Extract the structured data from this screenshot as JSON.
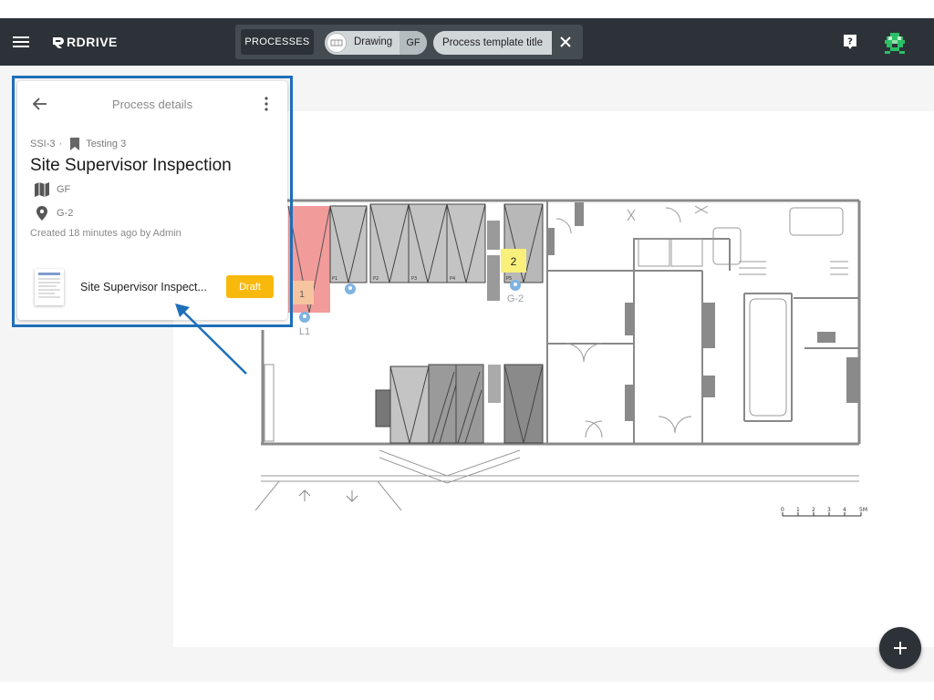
{
  "app": {
    "brand": "RDRIVE"
  },
  "toolbar": {
    "processes_label": "PROCESSES",
    "drawing_chip_label": "Drawing",
    "floor_chip_label": "GF",
    "template_chip_label": "Process template title"
  },
  "card": {
    "title": "Process details",
    "code": "SSI-3",
    "bookmark_label": "Testing 3",
    "process_title": "Site Supervisor Inspection",
    "floor": "GF",
    "location": "G-2",
    "created": "Created 18 minutes ago by Admin",
    "document_name": "Site Supervisor Inspect...",
    "status_label": "Draft"
  },
  "plan": {
    "pin_g2_number": "2",
    "pin_g2_label": "G-2",
    "pin_l1_label": "L1",
    "pin_l1_number": "1",
    "room_labels": [
      "P1",
      "P2",
      "P3",
      "P4",
      "P5"
    ],
    "scale_ticks": [
      "0",
      "1",
      "2",
      "3",
      "4",
      "5M"
    ]
  },
  "colors": {
    "topbar": "#2c3237",
    "accent_blue": "#1e6fb8",
    "draft": "#f9b90c",
    "pin": "#7fb3e0",
    "sticky_note": "#f8f07a",
    "zone_red": "#f08a8a"
  },
  "icons": {
    "menu": "hamburger-icon",
    "help": "help-icon",
    "avatar": "pixel-avatar-icon",
    "back": "arrow-left-icon",
    "kebab": "kebab-icon",
    "bookmark": "bookmark-icon",
    "map": "map-icon",
    "location": "location-pin-icon",
    "close": "close-icon",
    "add": "plus-icon"
  }
}
